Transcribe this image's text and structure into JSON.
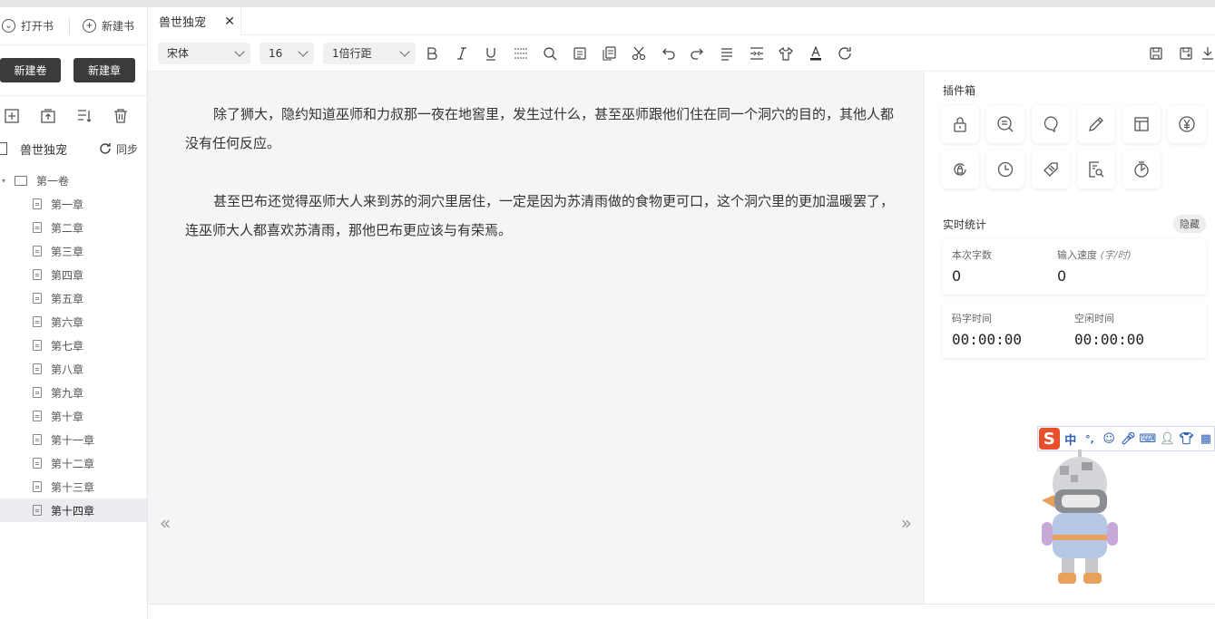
{
  "sidebar": {
    "open_book": "打开书",
    "new_book": "新建书",
    "new_volume": "新建卷",
    "new_chapter": "新建章",
    "book_title": "兽世独宠",
    "sync": "同步",
    "volume": "第一卷",
    "chapters": [
      "第一章",
      "第二章",
      "第三章",
      "第四章",
      "第五章",
      "第六章",
      "第七章",
      "第八章",
      "第九章",
      "第十章",
      "第十一章",
      "第十二章",
      "第十三章",
      "第十四章"
    ],
    "active_chapter_index": 13
  },
  "tabs": [
    {
      "label": "兽世独宠",
      "close": "✕"
    }
  ],
  "toolbar": {
    "font": "宋体",
    "size": "16",
    "line_spacing": "1倍行距",
    "icons": [
      "bold-icon",
      "italic-icon",
      "underline-icon",
      "strikethrough-icon",
      "search-icon",
      "note-icon",
      "copy-icon",
      "cut-icon",
      "undo-icon",
      "redo-icon",
      "align-icon",
      "indent-icon",
      "shirt-icon",
      "font-color-icon",
      "refresh-icon"
    ],
    "right_icons": [
      "save-icon",
      "save-as-icon",
      "download-icon"
    ]
  },
  "editor": {
    "paragraphs": [
      "除了狮大，隐约知道巫师和力叔那一夜在地窖里，发生过什么，甚至巫师跟他们住在同一个洞穴的目的，其他人都没有任何反应。",
      "甚至巴布还觉得巫师大人来到苏的洞穴里居住，一定是因为苏清雨做的食物更可口，这个洞穴里的更加温暖罢了，连巫师大人都喜欢苏清雨，那他巴布更应该与有荣焉。"
    ],
    "prev": "«",
    "next": "»"
  },
  "right_panel": {
    "plugins_title": "插件箱",
    "plugins": [
      "lock-icon",
      "word-icon",
      "chat-icon",
      "pen-icon",
      "layout-icon",
      "yen-icon",
      "lock-cycle-icon",
      "clock-icon",
      "tag-icon",
      "doc-search-icon",
      "timer-icon"
    ],
    "stats_title": "实时统计",
    "hide": "隐藏",
    "this_words_label": "本次字数",
    "this_words": "0",
    "speed_label": "输入速度",
    "speed_unit": "(字/时)",
    "speed": "0",
    "typing_time_label": "码字时间",
    "typing_time": "00:00:00",
    "idle_time_label": "空闲时间",
    "idle_time": "00:00:00"
  },
  "ime": {
    "logo": "S",
    "mode": "中",
    "punct": "°,"
  }
}
